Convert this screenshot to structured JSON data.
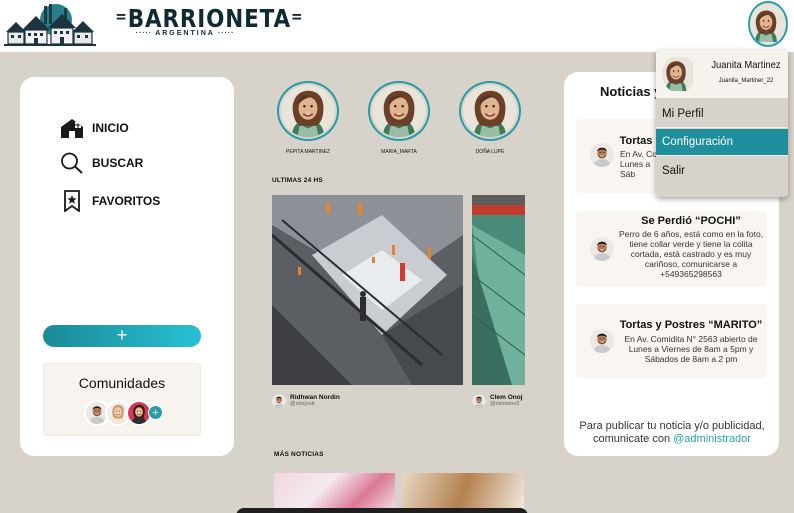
{
  "header": {
    "brand": "BARRIONETA",
    "brand_sub": "ARGENTINA"
  },
  "sidebar": {
    "items": [
      {
        "label": "INICIO",
        "icon": "home-icon"
      },
      {
        "label": "BUSCAR",
        "icon": "search-icon"
      },
      {
        "label": "FAVORITOS",
        "icon": "bookmark-star-icon"
      }
    ],
    "add_button": "+",
    "communities_title": "Comunidades",
    "communities_add": "+"
  },
  "stories": [
    {
      "name": "PEPITA MARTINEZ"
    },
    {
      "name": "MARIA_MARTA"
    },
    {
      "name": "DOÑA LUPE"
    }
  ],
  "sections": {
    "latest": "ULTIMAS 24 HS",
    "more": "MÁS NOTICIAS"
  },
  "posts": [
    {
      "author": "Ridhwan Nordin",
      "handle": "@ridzjoob"
    },
    {
      "author": "Clem Onoj",
      "handle": "@clemono2"
    }
  ],
  "news": {
    "title": "Noticias y",
    "items": [
      {
        "title": "Tortas",
        "description": "En Av. Co\nLunes a\nSáb"
      },
      {
        "title": "Se Perdió “POCHI”",
        "description": "Perro de 6 años, está como en la foto, tiene collar verde y tiene la colita cortada, está castrado y es muy cariñoso, comunicarse a +549365298563"
      },
      {
        "title": "Tortas y Postres “MARITO”",
        "description": "En Av. Comidita N° 2563 abierto de Lunes a Viernes de 8am a 5pm y Sábados de 8am a 2 pm"
      }
    ],
    "footer_text": "Para publicar tu noticia y/o publicidad, comunicate con",
    "footer_link": "@administrador"
  },
  "user_menu": {
    "name": "Juanita Martinez",
    "handle": "Juanita_Martiner_22",
    "items": [
      "Mi Perfil",
      "Configuración",
      "Salir"
    ],
    "active_item": "Configuración"
  },
  "colors": {
    "accent": "#1f8e9d",
    "background": "#d8d3ca"
  }
}
